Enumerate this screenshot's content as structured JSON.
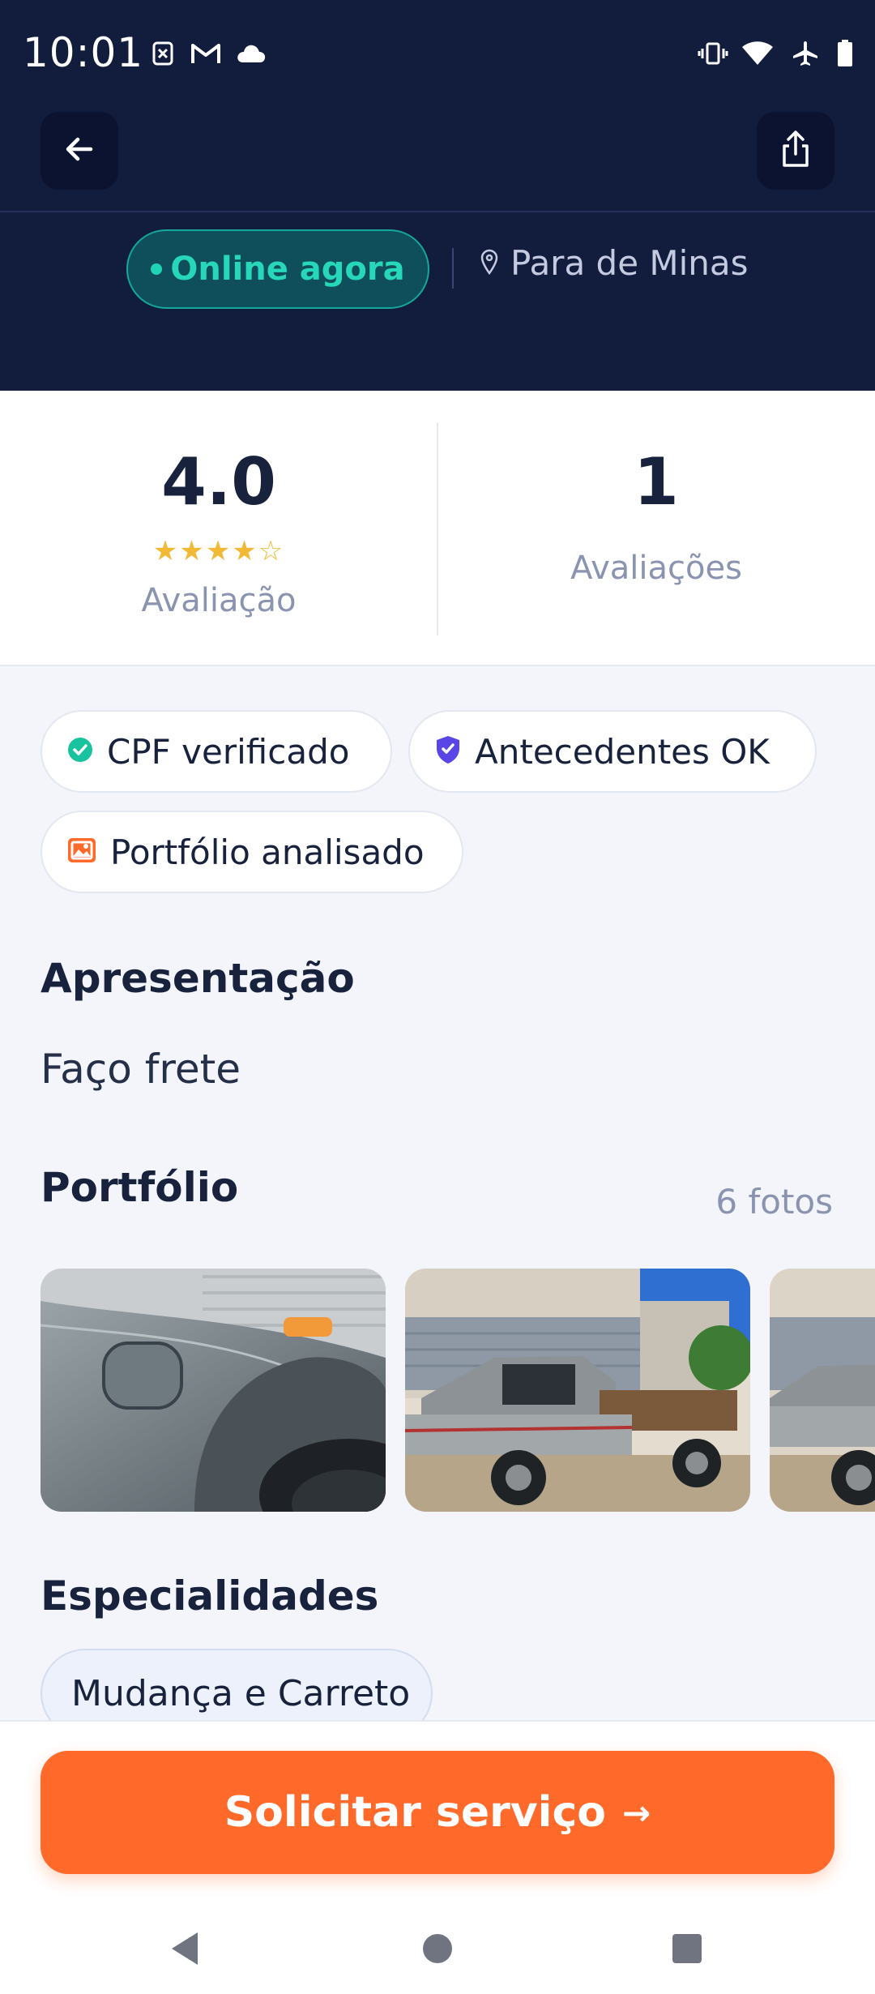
{
  "status_bar": {
    "time": "10:01",
    "left_icons": [
      "notification-x-icon",
      "gmail-icon",
      "cloud-icon"
    ],
    "right_icons": [
      "vibrate-icon",
      "wifi-icon",
      "airplane-icon",
      "battery-icon"
    ]
  },
  "header": {
    "back_icon": "arrow-left-icon",
    "share_icon": "share-icon",
    "online_label": "Online agora",
    "location": "Para de Minas"
  },
  "stats": {
    "rating_value": "4.0",
    "rating_stars": "★★★★☆",
    "rating_out_of_5": 4,
    "rating_label": "Avaliação",
    "reviews_value": "1",
    "reviews_label": "Avaliações"
  },
  "badges": [
    {
      "label": "CPF verificado",
      "icon": "check-circle-icon",
      "color": "#19c39f"
    },
    {
      "label": "Antecedentes OK",
      "icon": "shield-check-icon",
      "color": "#5a45e6"
    },
    {
      "label": "Portfólio analisado",
      "icon": "image-icon",
      "color": "#ff6a2a"
    }
  ],
  "intro": {
    "title": "Apresentação",
    "text": "Faço frete"
  },
  "portfolio": {
    "title": "Portfólio",
    "count_label": "6 fotos"
  },
  "specialties": {
    "title": "Especialidades",
    "items": [
      "Mudança e Carreto"
    ]
  },
  "cta": {
    "label": "Solicitar serviço",
    "arrow": "→"
  },
  "colors": {
    "header_bg": "#121c3d",
    "accent_orange": "#ff6a2a",
    "online_green": "#27d7b9",
    "star_yellow": "#f2b935"
  }
}
